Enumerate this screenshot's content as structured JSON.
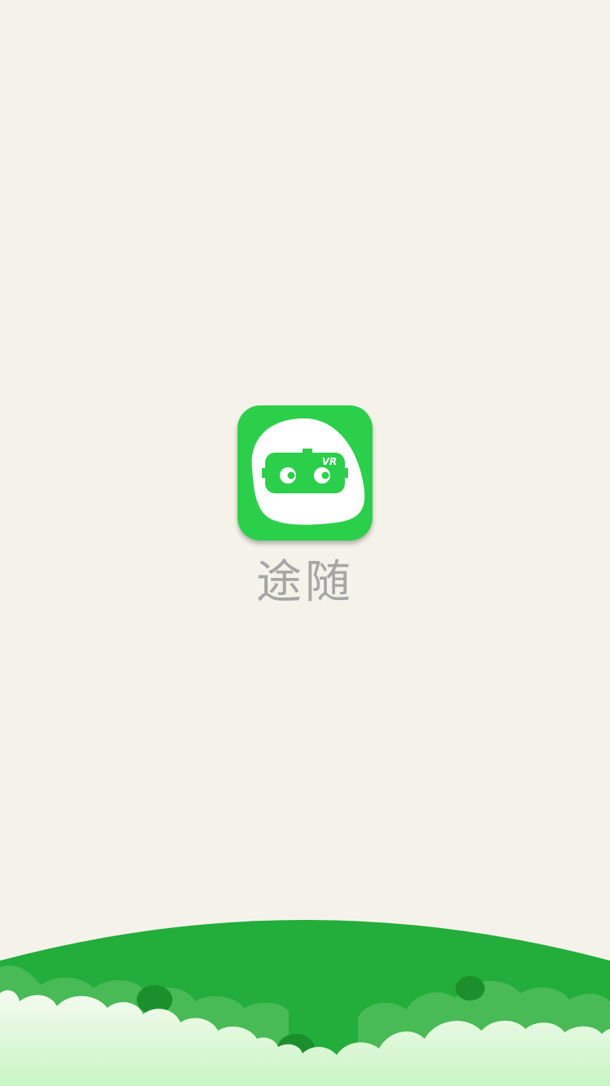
{
  "splash": {
    "app_name": "途随",
    "icon_badge": "VR",
    "logo_icon": "vr-headset-mascot-icon",
    "colors": {
      "background": "#f5f3e9",
      "brand_green": "#2bd04a",
      "app_name_text": "#a6a6a6",
      "hill_green": "#23ad3b",
      "cloud_light": "#d8f5d2"
    }
  }
}
